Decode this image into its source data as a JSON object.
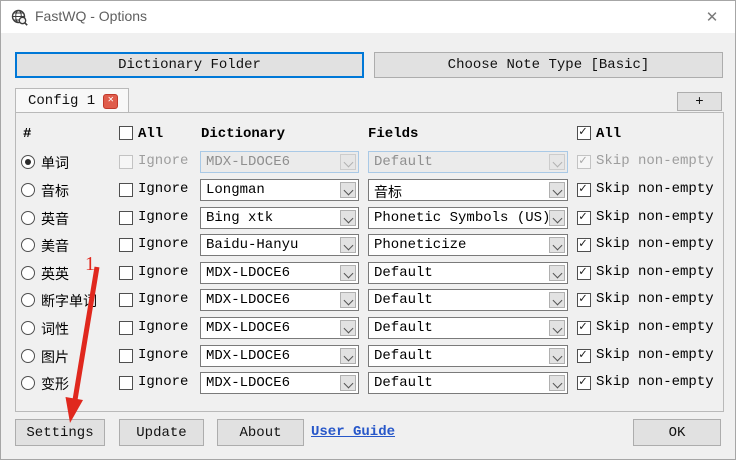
{
  "window": {
    "title": "FastWQ - Options",
    "close_glyph": "✕"
  },
  "top_buttons": {
    "dictionary_folder": "Dictionary Folder",
    "choose_note_type": "Choose Note Type [Basic]"
  },
  "tabs": {
    "config_tab": "Config 1",
    "tab_close_glyph": "✕",
    "add_button": "+"
  },
  "table": {
    "headers": {
      "num": "#",
      "all_left": "All",
      "dictionary": "Dictionary",
      "fields": "Fields",
      "all_right": "All"
    },
    "all_left_checked": false,
    "all_right_checked": true,
    "ignore_label": "Ignore",
    "skip_label": "Skip non-empty",
    "rows": [
      {
        "label": "单词",
        "selected": true,
        "disabled": true,
        "ignore_checked": false,
        "dictionary": "MDX-LDOCE6",
        "fields": "Default",
        "skip_checked": true
      },
      {
        "label": "音标",
        "selected": false,
        "disabled": false,
        "ignore_checked": false,
        "dictionary": "Longman",
        "fields": "音标",
        "skip_checked": true
      },
      {
        "label": "英音",
        "selected": false,
        "disabled": false,
        "ignore_checked": false,
        "dictionary": "Bing xtk",
        "fields": "Phonetic Symbols (US)",
        "skip_checked": true
      },
      {
        "label": "美音",
        "selected": false,
        "disabled": false,
        "ignore_checked": false,
        "dictionary": "Baidu-Hanyu",
        "fields": "Phoneticize",
        "skip_checked": true
      },
      {
        "label": "英英",
        "selected": false,
        "disabled": false,
        "ignore_checked": false,
        "dictionary": "MDX-LDOCE6",
        "fields": "Default",
        "skip_checked": true
      },
      {
        "label": "断字单词",
        "selected": false,
        "disabled": false,
        "ignore_checked": false,
        "dictionary": "MDX-LDOCE6",
        "fields": "Default",
        "skip_checked": true
      },
      {
        "label": "词性",
        "selected": false,
        "disabled": false,
        "ignore_checked": false,
        "dictionary": "MDX-LDOCE6",
        "fields": "Default",
        "skip_checked": true
      },
      {
        "label": "图片",
        "selected": false,
        "disabled": false,
        "ignore_checked": false,
        "dictionary": "MDX-LDOCE6",
        "fields": "Default",
        "skip_checked": true
      },
      {
        "label": "变形",
        "selected": false,
        "disabled": false,
        "ignore_checked": false,
        "dictionary": "MDX-LDOCE6",
        "fields": "Default",
        "skip_checked": true
      }
    ]
  },
  "footer": {
    "settings": "Settings",
    "update": "Update",
    "about": "About",
    "user_guide": "User Guide",
    "ok": "OK"
  },
  "annotation": {
    "step_number": "1"
  },
  "colors": {
    "focus_border_blue": "#0078d7",
    "annotation_red": "#e0281e",
    "link_blue": "#2757c9",
    "tab_close_red": "#e05c4b",
    "dialog_bg": "#f0f0f0",
    "titlebar_bg": "#ffffff"
  }
}
